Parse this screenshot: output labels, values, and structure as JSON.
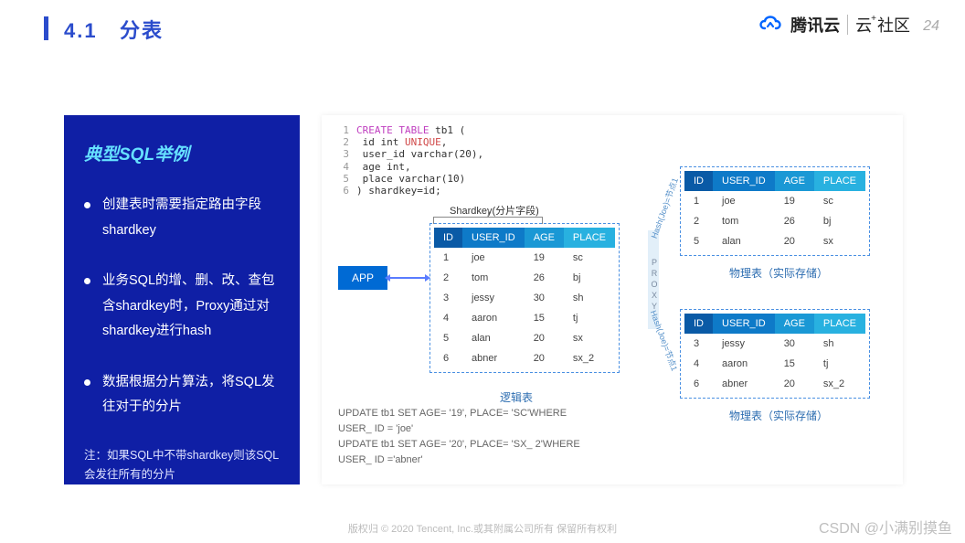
{
  "page_number": "24",
  "section_number": "4.1",
  "section_title": "分表",
  "logo": {
    "tencent_cloud": "腾讯云",
    "community": "云",
    "community_suffix": "社区"
  },
  "sidebar": {
    "title": "典型SQL举例",
    "bullets": [
      "创建表时需要指定路由字段shardkey",
      "业务SQL的增、删、改、查包含shardkey时，Proxy通过对shardkey进行hash",
      "数据根据分片算法，将SQL发往对于的分片"
    ],
    "note": "注：如果SQL中不带shardkey则该SQL会发往所有的分片"
  },
  "sql": {
    "lines": [
      {
        "n": "1",
        "kw": "CREATE TABLE",
        "rest": " tb1 ("
      },
      {
        "n": "2",
        "indent": "    ",
        "rest": "id int ",
        "kw2": "UNIQUE",
        "rest2": ","
      },
      {
        "n": "3",
        "indent": "    ",
        "rest": "user_id varchar(20),"
      },
      {
        "n": "4",
        "indent": "    ",
        "rest": "age int,"
      },
      {
        "n": "5",
        "indent": "    ",
        "rest": "place varchar(10)"
      },
      {
        "n": "6",
        "rest": ") shardkey=id;"
      }
    ]
  },
  "shardkey_label": "Shardkey(分片字段)",
  "app_label": "APP",
  "proxy_label": "PROXY",
  "hash_label_1": "Hash(Joe)=节点1",
  "hash_label_2": "Hash(Joe)=节点1",
  "tables": {
    "headers": [
      "ID",
      "USER_ID",
      "AGE",
      "PLACE"
    ],
    "logic_label": "逻辑表",
    "physical_label": "物理表（实际存储）",
    "logic": [
      [
        "1",
        "joe",
        "19",
        "sc"
      ],
      [
        "2",
        "tom",
        "26",
        "bj"
      ],
      [
        "3",
        "jessy",
        "30",
        "sh"
      ],
      [
        "4",
        "aaron",
        "15",
        "tj"
      ],
      [
        "5",
        "alan",
        "20",
        "sx"
      ],
      [
        "6",
        "abner",
        "20",
        "sx_2"
      ]
    ],
    "phys1": [
      [
        "1",
        "joe",
        "19",
        "sc"
      ],
      [
        "2",
        "tom",
        "26",
        "bj"
      ],
      [
        "5",
        "alan",
        "20",
        "sx"
      ]
    ],
    "phys2": [
      [
        "3",
        "jessy",
        "30",
        "sh"
      ],
      [
        "4",
        "aaron",
        "15",
        "tj"
      ],
      [
        "6",
        "abner",
        "20",
        "sx_2"
      ]
    ]
  },
  "updates": [
    "UPDATE tb1 SET AGE= '19', PLACE= 'SC'WHERE",
    "USER_ ID = 'joe'",
    "UPDATE tb1 SET AGE= '20', PLACE= 'SX_ 2'WHERE",
    "USER_ ID ='abner'"
  ],
  "copyright": "版权归 © 2020 Tencent, Inc.或其附属公司所有 保留所有权利",
  "watermark": "CSDN @小满别摸鱼"
}
